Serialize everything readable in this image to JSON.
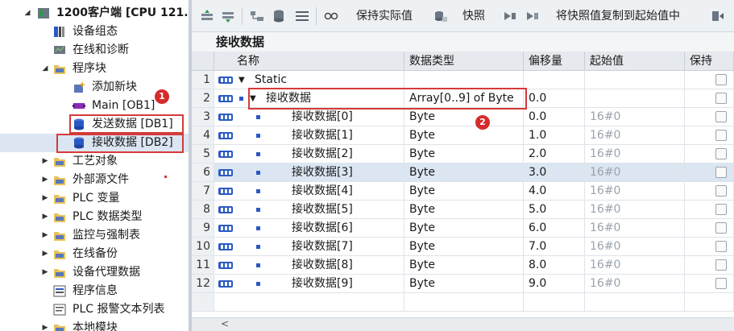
{
  "tree": {
    "items": [
      {
        "label": "1200客户端 [CPU 121...",
        "expand": "◢",
        "icon": "cpu-icon"
      },
      {
        "label": "设备组态",
        "expand": "",
        "icon": "device-config-icon"
      },
      {
        "label": "在线和诊断",
        "expand": "",
        "icon": "online-diagnostics-icon"
      },
      {
        "label": "程序块",
        "expand": "◢",
        "icon": "folder-icon"
      },
      {
        "label": "添加新块",
        "expand": "",
        "icon": "add-block-icon"
      },
      {
        "label": "Main [OB1]",
        "expand": "",
        "icon": "ob-block-icon"
      },
      {
        "label": "发送数据 [DB1]",
        "expand": "",
        "icon": "db-block-icon"
      },
      {
        "label": "接收数据 [DB2]",
        "expand": "",
        "icon": "db-block-icon"
      },
      {
        "label": "工艺对象",
        "expand": "▶",
        "icon": "folder-icon"
      },
      {
        "label": "外部源文件",
        "expand": "▶",
        "icon": "folder-icon"
      },
      {
        "label": "PLC 变量",
        "expand": "▶",
        "icon": "folder-icon"
      },
      {
        "label": "PLC 数据类型",
        "expand": "▶",
        "icon": "folder-icon"
      },
      {
        "label": "监控与强制表",
        "expand": "▶",
        "icon": "folder-icon"
      },
      {
        "label": "在线备份",
        "expand": "▶",
        "icon": "folder-icon"
      },
      {
        "label": "设备代理数据",
        "expand": "▶",
        "icon": "folder-icon"
      },
      {
        "label": "程序信息",
        "expand": "",
        "icon": "program-info-icon"
      },
      {
        "label": "PLC 报警文本列表",
        "expand": "",
        "icon": "alarm-text-icon"
      },
      {
        "label": "本地模块",
        "expand": "▶",
        "icon": "folder-icon"
      }
    ],
    "badge1": "1"
  },
  "toolbar": {
    "keep_actual": "保持实际值",
    "snapshot": "快照",
    "copy_snapshot": "将快照值复制到起始值中"
  },
  "db_title": "接收数据",
  "grid": {
    "headers": {
      "name": "名称",
      "type": "数据类型",
      "offset": "偏移量",
      "start": "起始值",
      "retain": "保持"
    },
    "rows": [
      {
        "num": "1",
        "expand": "▼",
        "name": "Static",
        "type": "",
        "offset": "",
        "start": "",
        "level": 0
      },
      {
        "num": "2",
        "expand": "▼",
        "name": "接收数据",
        "type": "Array[0..9] of Byte",
        "offset": "0.0",
        "start": "",
        "level": 1
      },
      {
        "num": "3",
        "expand": "",
        "name": "接收数据[0]",
        "type": "Byte",
        "offset": "0.0",
        "start": "16#0",
        "level": 2
      },
      {
        "num": "4",
        "expand": "",
        "name": "接收数据[1]",
        "type": "Byte",
        "offset": "1.0",
        "start": "16#0",
        "level": 2
      },
      {
        "num": "5",
        "expand": "",
        "name": "接收数据[2]",
        "type": "Byte",
        "offset": "2.0",
        "start": "16#0",
        "level": 2
      },
      {
        "num": "6",
        "expand": "",
        "name": "接收数据[3]",
        "type": "Byte",
        "offset": "3.0",
        "start": "16#0",
        "level": 2
      },
      {
        "num": "7",
        "expand": "",
        "name": "接收数据[4]",
        "type": "Byte",
        "offset": "4.0",
        "start": "16#0",
        "level": 2
      },
      {
        "num": "8",
        "expand": "",
        "name": "接收数据[5]",
        "type": "Byte",
        "offset": "5.0",
        "start": "16#0",
        "level": 2
      },
      {
        "num": "9",
        "expand": "",
        "name": "接收数据[6]",
        "type": "Byte",
        "offset": "6.0",
        "start": "16#0",
        "level": 2
      },
      {
        "num": "10",
        "expand": "",
        "name": "接收数据[7]",
        "type": "Byte",
        "offset": "7.0",
        "start": "16#0",
        "level": 2
      },
      {
        "num": "11",
        "expand": "",
        "name": "接收数据[8]",
        "type": "Byte",
        "offset": "8.0",
        "start": "16#0",
        "level": 2
      },
      {
        "num": "12",
        "expand": "",
        "name": "接收数据[9]",
        "type": "Byte",
        "offset": "9.0",
        "start": "16#0",
        "level": 2
      }
    ],
    "badge2": "2"
  },
  "scroll": {
    "left_arrow": "<"
  },
  "colors": {
    "accent_red": "#d43a3a",
    "selected_row": "#dbe6f2",
    "db_blue": "#2b59c3"
  }
}
